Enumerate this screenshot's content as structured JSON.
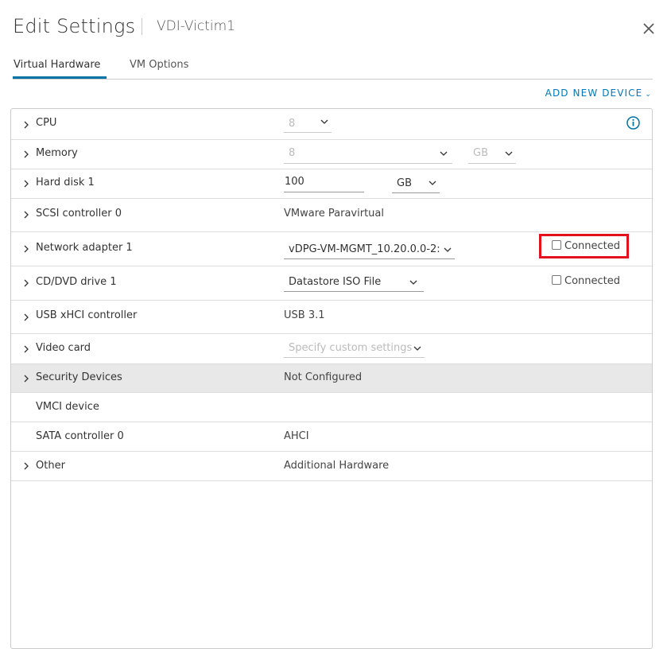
{
  "dialog": {
    "title": "Edit Settings",
    "vm_name": "VDI-Victim1"
  },
  "tabs": [
    {
      "label": "Virtual Hardware",
      "active": true
    },
    {
      "label": "VM Options",
      "active": false
    }
  ],
  "actions": {
    "add_new_device": "ADD NEW DEVICE"
  },
  "devices": {
    "cpu": {
      "label": "CPU",
      "value": "8"
    },
    "memory": {
      "label": "Memory",
      "value": "8",
      "unit": "GB"
    },
    "hard_disk": {
      "label": "Hard disk 1",
      "value": "100",
      "unit": "GB"
    },
    "scsi": {
      "label": "SCSI controller 0",
      "value": "VMware Paravirtual"
    },
    "network": {
      "label": "Network adapter 1",
      "value": "vDPG-VM-MGMT_10.20.0.0-2:",
      "connected_label": "Connected",
      "connected": false
    },
    "cdrom": {
      "label": "CD/DVD drive 1",
      "value": "Datastore ISO File",
      "connected_label": "Connected",
      "connected": false
    },
    "usb": {
      "label": "USB xHCI controller",
      "value": "USB 3.1"
    },
    "video": {
      "label": "Video card",
      "value": "Specify custom settings"
    },
    "security": {
      "label": "Security Devices",
      "value": "Not Configured"
    },
    "vmci": {
      "label": "VMCI device",
      "value": ""
    },
    "sata": {
      "label": "SATA controller 0",
      "value": "AHCI"
    },
    "other": {
      "label": "Other",
      "value": "Additional Hardware"
    }
  },
  "colors": {
    "accent": "#0072a3",
    "link": "#0079b8",
    "highlight": "#e3101e"
  }
}
